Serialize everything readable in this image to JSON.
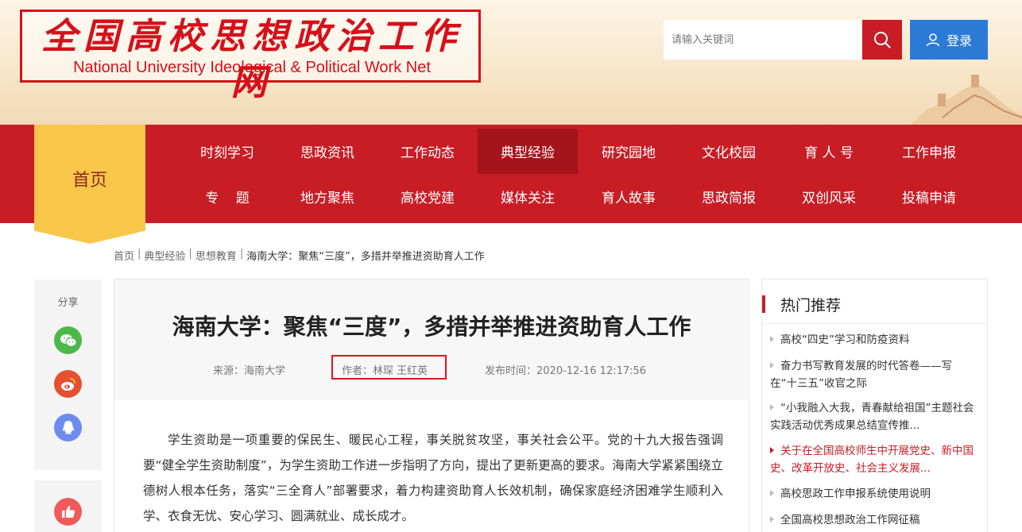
{
  "header": {
    "logo_cn": "全国高校思想政治工作网",
    "logo_en": "National University Ideological & Political Work Net",
    "search_placeholder": "请输入关键词",
    "login_label": "登录"
  },
  "nav": {
    "home": "首页",
    "row1": [
      "时刻学习",
      "思政资讯",
      "工作动态",
      "典型经验",
      "研究园地",
      "文化校园",
      "育 人 号",
      "工作申报"
    ],
    "row2": [
      "专    题",
      "地方聚焦",
      "高校党建",
      "媒体关注",
      "育人故事",
      "思政简报",
      "双创风采",
      "投稿申请"
    ],
    "active": "典型经验"
  },
  "breadcrumb": {
    "items": [
      "首页",
      "典型经验",
      "思想教育"
    ],
    "current": "海南大学：聚焦“三度”，多措并举推进资助育人工作",
    "separator": "|"
  },
  "share": {
    "label": "分享",
    "icons": [
      "wechat-icon",
      "weibo-icon",
      "qq-icon"
    ],
    "like_icon": "thumbs-up-icon"
  },
  "article": {
    "title": "海南大学：聚焦“三度”，多措并举推进资助育人工作",
    "source": "来源：海南大学",
    "author": "作者：林琛 王红英",
    "published": "发布时间：2020-12-16 12:17:56",
    "body": "学生资助是一项重要的保民生、暖民心工程，事关脱贫攻坚，事关社会公平。党的十九大报告强调要“健全学生资助制度”，为学生资助工作进一步指明了方向，提出了更新更高的要求。海南大学紧紧围绕立德树人根本任务，落实“三全育人”部署要求，着力构建资助育人长效机制，确保家庭经济困难学生顺利入学、衣食无忧、安心学习、圆满就业、成长成才。"
  },
  "hot": {
    "title": "热门推荐",
    "items": [
      "高校“四史”学习和防疫资料",
      "奋力书写教育发展的时代答卷——写在“十三五”收官之际",
      "“小我融入大我，青春献给祖国”主题社会实践活动优秀成果总结宣传推...",
      "关于在全国高校师生中开展党史、新中国史、改革开放史、社会主义发展...",
      "高校思政工作申报系统使用说明",
      "全国高校思想政治工作网征稿"
    ]
  },
  "colors": {
    "brand_red": "#c81d25",
    "nav_active": "#a5131b",
    "home_yellow": "#f8c74a",
    "login_blue": "#2b7bd6"
  }
}
